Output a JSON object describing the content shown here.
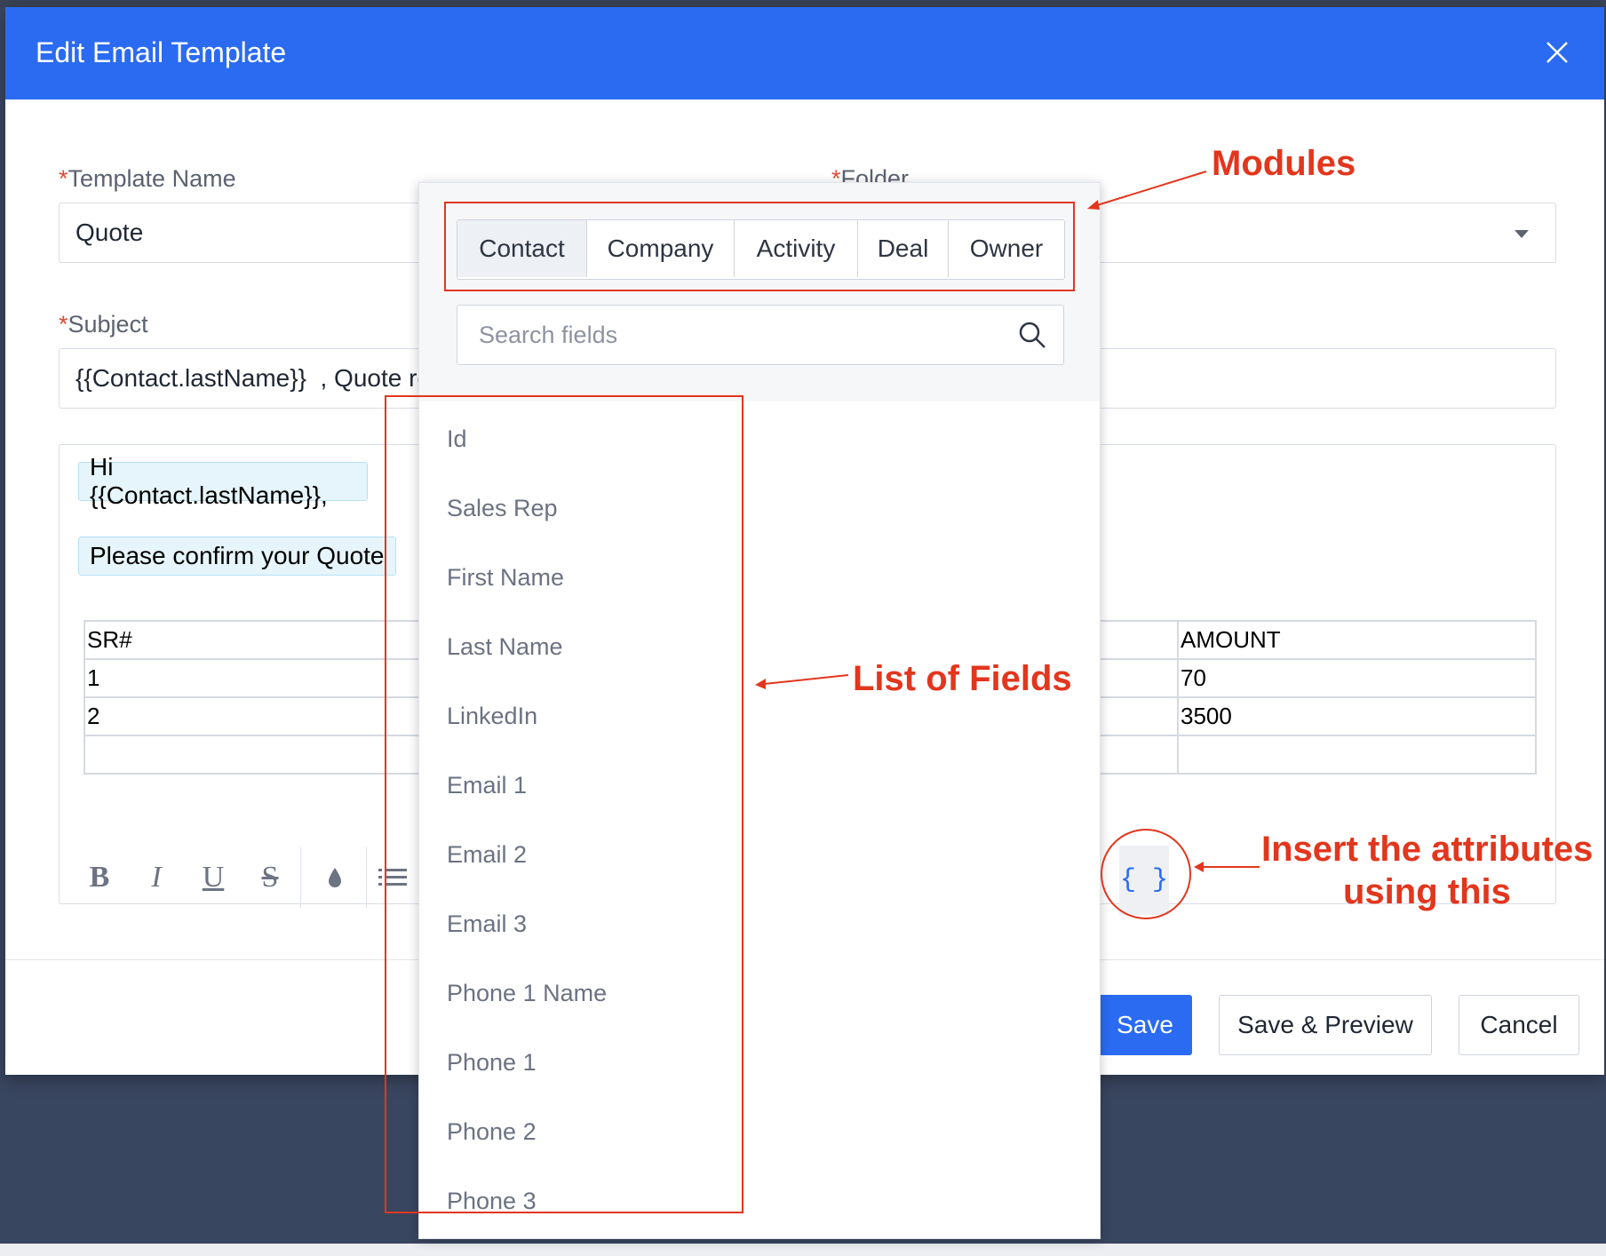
{
  "modal": {
    "title": "Edit Email Template",
    "close_icon": "close-icon"
  },
  "form": {
    "required_mark": "*",
    "template_name_label": "Template Name",
    "template_name_value": "Quote",
    "folder_label": "Folder",
    "subject_label": "Subject",
    "subject_value": "{{Contact.lastName}}  , Quote re"
  },
  "editor": {
    "greeting": "Hi {{Contact.lastName}},",
    "line": "Please confirm your Quote",
    "table": {
      "headers": [
        "SR#",
        "AMOUNT"
      ],
      "rows": [
        [
          "1",
          "70"
        ],
        [
          "2",
          "3500"
        ],
        [
          "",
          ""
        ]
      ]
    },
    "toolbar": {
      "bold": "B",
      "italic": "I",
      "underline": "U",
      "strike": "S",
      "color_icon": "drop-icon",
      "list_icon": "list-icon",
      "insert_attribute": "{ }"
    }
  },
  "footer": {
    "save": "Save",
    "save_preview": "Save & Preview",
    "cancel": "Cancel"
  },
  "picker": {
    "tabs": [
      "Contact",
      "Company",
      "Activity",
      "Deal",
      "Owner"
    ],
    "active_tab": "Contact",
    "search_placeholder": "Search fields",
    "fields": [
      "Id",
      "Sales Rep",
      "First Name",
      "Last Name",
      "LinkedIn",
      "Email 1",
      "Email 2",
      "Email 3",
      "Phone 1 Name",
      "Phone 1",
      "Phone 2",
      "Phone 3"
    ]
  },
  "annotations": {
    "modules": "Modules",
    "list_of_fields": "List of Fields",
    "insert_line1": "Insert the attributes",
    "insert_line2": "using this"
  },
  "colors": {
    "header": "#2a6bf2",
    "annotation": "#e2361d",
    "backdrop": "#3a4762"
  }
}
